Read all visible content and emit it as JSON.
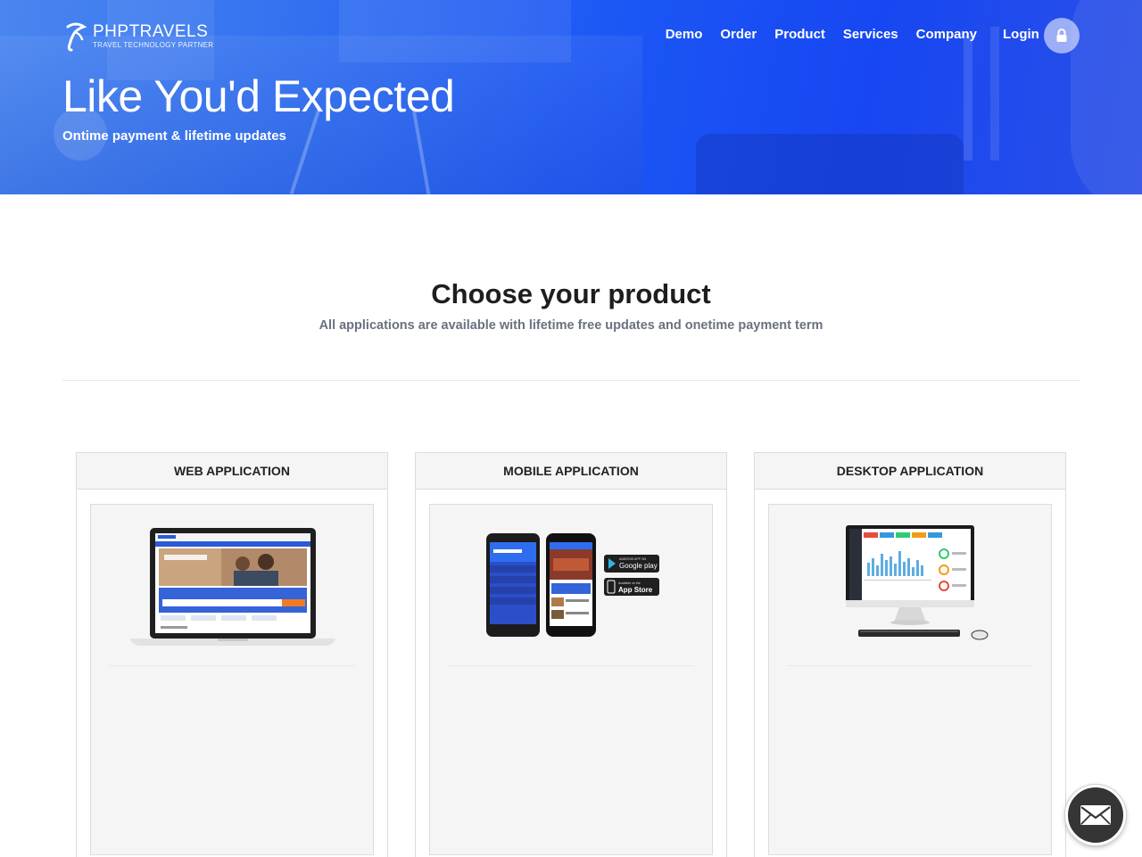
{
  "brand": {
    "name": "PHPTRAVELS",
    "tagline": "TRAVEL TECHNOLOGY PARTNER"
  },
  "nav": {
    "items": [
      "Demo",
      "Order",
      "Product",
      "Services",
      "Company"
    ],
    "login_label": "Login"
  },
  "hero": {
    "title": "Like You'd Expected",
    "subtitle": "Ontime payment & lifetime updates"
  },
  "section": {
    "title": "Choose your product",
    "subtitle": "All applications are available with lifetime free updates and onetime payment term"
  },
  "products": [
    {
      "title": "WEB APPLICATION",
      "image": "laptop-screenshot"
    },
    {
      "title": "MOBILE APPLICATION",
      "image": "phones-screenshot"
    },
    {
      "title": "DESKTOP APPLICATION",
      "image": "desktop-screenshot"
    }
  ],
  "store_badges": {
    "google": "Google play",
    "apple": "App Store",
    "google_small": "ANDROID APP ON",
    "apple_small": "Available on the"
  },
  "colors": {
    "hero_blue": "#1b55f5",
    "accent_orange": "#f07c22",
    "mail_button": "#353535"
  },
  "icons": {
    "lock": "lock-icon",
    "mail": "envelope-icon",
    "logo": "phptravels-logo-icon"
  }
}
